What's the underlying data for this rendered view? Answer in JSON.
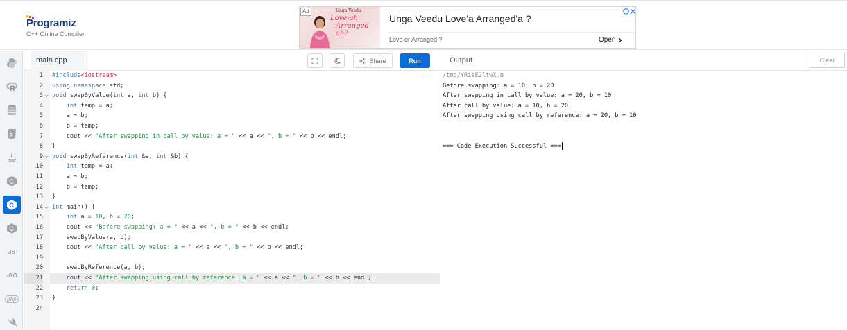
{
  "header": {
    "logo_text": "Programiz",
    "logo_subtitle": "C++ Online Compiler"
  },
  "ad": {
    "badge": "Ad",
    "image_text_top": "Unga Veedu",
    "image_text_mid": "Love-ah",
    "image_text_bottom": "Arranged-ah?",
    "title": "Unga Veedu Love'a Arranged'a ?",
    "subtitle": "Love or Arranged ?",
    "open_label": "Open"
  },
  "languages": [
    {
      "name": "python",
      "active": false
    },
    {
      "name": "r",
      "active": false
    },
    {
      "name": "sql",
      "active": false
    },
    {
      "name": "html",
      "active": false
    },
    {
      "name": "java",
      "active": false
    },
    {
      "name": "c",
      "active": false
    },
    {
      "name": "cpp",
      "active": true
    },
    {
      "name": "csharp",
      "active": false
    },
    {
      "name": "javascript",
      "label": "JS",
      "active": false
    },
    {
      "name": "go",
      "label": "-GO",
      "active": false
    },
    {
      "name": "php",
      "label": "php",
      "active": false
    },
    {
      "name": "swift",
      "active": false
    }
  ],
  "editor": {
    "tab_name": "main.cpp",
    "share_label": "Share",
    "run_label": "Run",
    "highlighted_line": 21,
    "line_numbers": [
      "1",
      "2",
      "3",
      "4",
      "5",
      "6",
      "7",
      "8",
      "9",
      "10",
      "11",
      "12",
      "13",
      "14",
      "15",
      "16",
      "17",
      "18",
      "19",
      "20",
      "21",
      "22",
      "23",
      "24"
    ],
    "code": {
      "l1_a": "#include",
      "l1_b": "<iostream>",
      "l2_a": "using namespace",
      "l2_b": " std;",
      "l3_a": "void",
      "l3_b": " swapByValue(",
      "l3_c": "int",
      "l3_d": " a, ",
      "l3_e": "int",
      "l3_f": " b) {",
      "l4_a": "    int",
      "l4_b": " temp = a;",
      "l5": "    a = b;",
      "l6": "    b = temp;",
      "l7_a": "    cout << ",
      "l7_b": "\"After swapping in call by value: a = \"",
      "l7_c": " << a << ",
      "l7_d": "\", b = \"",
      "l7_e": " << b << endl;",
      "l8": "}",
      "l9_a": "void",
      "l9_b": " swapByReference(",
      "l9_c": "int",
      "l9_d": " &a, ",
      "l9_e": "int",
      "l9_f": " &b) {",
      "l10_a": "    int",
      "l10_b": " temp = a;",
      "l11": "    a = b;",
      "l12": "    b = temp;",
      "l13": "}",
      "l14_a": "int",
      "l14_b": " main() {",
      "l15_a": "    int",
      "l15_b": " a = ",
      "l15_c": "10",
      "l15_d": ", b = ",
      "l15_e": "20",
      "l15_f": ";",
      "l16_a": "    cout << ",
      "l16_b": "\"Before swapping: a = \"",
      "l16_c": " << a << ",
      "l16_d": "\", b = \"",
      "l16_e": " << b << endl;",
      "l17": "    swapByValue(a, b);",
      "l18_a": "    cout << ",
      "l18_b": "\"After call by value: a = \"",
      "l18_c": " << a << ",
      "l18_d": "\", b = \"",
      "l18_e": " << b << endl;",
      "l19": "",
      "l20": "    swapByReference(a, b);",
      "l21_a": "    cout << ",
      "l21_b": "\"After swapping using call by reference: a = \"",
      "l21_c": " << a << ",
      "l21_d": "\", b = \"",
      "l21_e": " << b << endl;",
      "l22_a": "    return",
      "l22_b": " 0",
      "l22_c": ";",
      "l23": "}",
      "l24": ""
    }
  },
  "output": {
    "title": "Output",
    "clear_label": "Clear",
    "lines": [
      "/tmp/YRisE2ltwX.o",
      "Before swapping: a = 10, b = 20",
      "After swapping in call by value: a = 20, b = 10",
      "After call by value: a = 10, b = 20",
      "After swapping using call by reference: a = 20, b = 10",
      "",
      "",
      "=== Code Execution Successful ==="
    ]
  },
  "colors": {
    "accent": "#0d6cd6",
    "keyword": "#3d7aa8",
    "string": "#2c8a4b"
  }
}
